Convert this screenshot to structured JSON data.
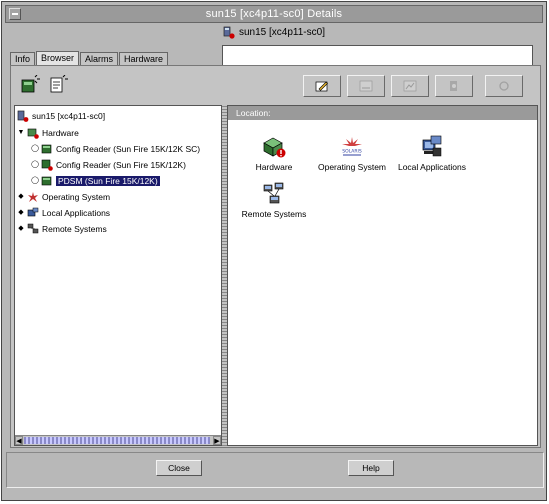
{
  "window": {
    "title": "sun15 [xc4p11-sc0] Details",
    "header_label": "sun15 [xc4p11-sc0]"
  },
  "tabs": [
    {
      "label": "Info"
    },
    {
      "label": "Browser"
    },
    {
      "label": "Alarms"
    },
    {
      "label": "Hardware"
    }
  ],
  "tree": {
    "root": "sun15 [xc4p11-sc0]",
    "items": [
      {
        "label": "Hardware",
        "expander": "expanded"
      },
      {
        "label": "Config Reader (Sun Fire 15K/12K SC)",
        "expander": "collapsed"
      },
      {
        "label": "Config Reader (Sun Fire 15K/12K)",
        "expander": "collapsed"
      },
      {
        "label": "PDSM (Sun Fire 15K/12K)",
        "expander": "collapsed"
      },
      {
        "label": "Operating System",
        "expander": "collapsed"
      },
      {
        "label": "Local Applications",
        "expander": "collapsed"
      },
      {
        "label": "Remote Systems",
        "expander": "collapsed"
      }
    ]
  },
  "location": {
    "label": "Location:"
  },
  "content_items": [
    {
      "label": "Hardware",
      "icon": "hardware-icon"
    },
    {
      "label": "Operating System",
      "icon": "solaris-icon"
    },
    {
      "label": "Local Applications",
      "icon": "local-applications-icon"
    },
    {
      "label": "Remote Systems",
      "icon": "remote-systems-icon"
    }
  ],
  "buttons": {
    "close": "Close",
    "help": "Help"
  },
  "colors": {
    "selection": "#1a1a6a",
    "location_bar": "#9a9a9a",
    "alarm_red": "#cc0000"
  }
}
